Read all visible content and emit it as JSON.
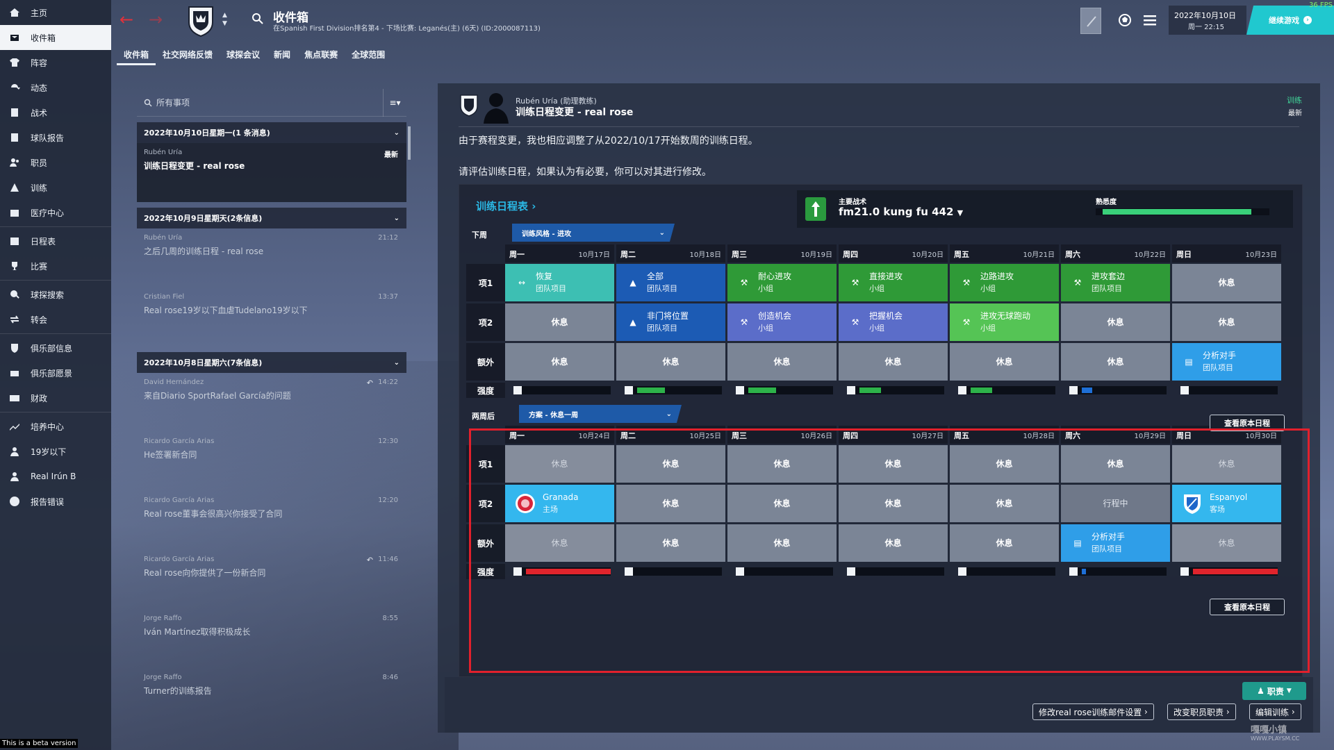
{
  "sidebar": {
    "items": [
      {
        "label": "主页",
        "icon": "home-icon"
      },
      {
        "label": "收件箱",
        "icon": "inbox-icon",
        "active": true
      },
      {
        "label": "阵容",
        "icon": "shirt-icon"
      },
      {
        "label": "动态",
        "icon": "dynamics-icon"
      },
      {
        "label": "战术",
        "icon": "tactics-icon"
      },
      {
        "label": "球队报告",
        "icon": "report-icon"
      },
      {
        "label": "职员",
        "icon": "staff-icon"
      },
      {
        "label": "训练",
        "icon": "training-icon"
      },
      {
        "label": "医疗中心",
        "icon": "medical-icon"
      },
      {
        "label": "日程表",
        "icon": "calendar-icon"
      },
      {
        "label": "比赛",
        "icon": "trophy-icon"
      },
      {
        "label": "球探搜索",
        "icon": "scout-icon"
      },
      {
        "label": "转会",
        "icon": "transfer-icon"
      },
      {
        "label": "俱乐部信息",
        "icon": "club-shield-icon"
      },
      {
        "label": "俱乐部愿景",
        "icon": "vision-icon"
      },
      {
        "label": "财政",
        "icon": "finance-icon"
      },
      {
        "label": "培养中心",
        "icon": "development-icon"
      },
      {
        "label": "19岁以下",
        "icon": "u19-icon"
      },
      {
        "label": "Real Irún B",
        "icon": "reserve-icon"
      },
      {
        "label": "报告错误",
        "icon": "alert-icon"
      }
    ]
  },
  "header": {
    "title": "收件箱",
    "subtitle": "在Spanish First Division排名第4 - 下场比赛: Leganés(主) (6天) (ID:2000087113)",
    "tabs": [
      "收件箱",
      "社交网络反馈",
      "球探会议",
      "新闻",
      "焦点联赛",
      "全球范围"
    ],
    "date": "2022年10月10日",
    "day_time": "周一 22:15",
    "continue_label": "继续游戏",
    "fps": "36 FPS"
  },
  "inbox": {
    "search_placeholder": "所有事项",
    "groups": [
      {
        "title": "2022年10月10日星期一(1 条消息)",
        "messages": [
          {
            "from": "Rubén Uría",
            "subject": "训练日程变更 - real rose",
            "time": "最新",
            "selected": true
          }
        ]
      },
      {
        "title": "2022年10月9日星期天(2条信息)",
        "messages": [
          {
            "from": "Rubén Uría",
            "subject": "之后几周的训练日程 - real rose",
            "time": "21:12"
          },
          {
            "from": "Cristian Fiel",
            "subject": "Real rose19岁以下血虐Tudelano19岁以下",
            "time": "13:37"
          }
        ]
      },
      {
        "title": "2022年10月8日星期六(7条信息)",
        "messages": [
          {
            "from": "David Hernández",
            "subject": "来自Diario SportRafael García的问题",
            "time": "14:22",
            "reply": true
          },
          {
            "from": "Ricardo García Arias",
            "subject": "He签署新合同",
            "time": "12:30"
          },
          {
            "from": "Ricardo García Arias",
            "subject": "Real rose董事会很高兴你接受了合同",
            "time": "12:20"
          },
          {
            "from": "Ricardo García Arias",
            "subject": "Real rose向你提供了一份新合同",
            "time": "11:46",
            "reply": true
          },
          {
            "from": "Jorge Raffo",
            "subject": "Iván Martínez取得积极成长",
            "time": "8:55"
          },
          {
            "from": "Jorge Raffo",
            "subject": "Turner的训练报告",
            "time": "8:46"
          }
        ]
      }
    ]
  },
  "message": {
    "from": "Rubén Uría (助理教练)",
    "title": "训练日程变更 - real rose",
    "tag": "训练",
    "tag_new": "最新",
    "body1": "由于赛程变更，我也相应调整了从2022/10/17开始数周的训练日程。",
    "body2": "请评估训练日程，如果认为有必要，你可以对其进行修改。"
  },
  "schedule": {
    "title": "训练日程表",
    "tactic_label": "主要战术",
    "tactic_value": "fm21.0 kung fu 442",
    "familiarity_label": "熟悉度",
    "familiarity": 0.93,
    "row_labels": [
      "项1",
      "项2",
      "额外",
      "强度"
    ],
    "view_original": "查看原本日程",
    "weeks": [
      {
        "label": "下周",
        "plan": "训练风格 - 进攻",
        "days": [
          {
            "d": "周一",
            "date": "10月17日"
          },
          {
            "d": "周二",
            "date": "10月18日"
          },
          {
            "d": "周三",
            "date": "10月19日"
          },
          {
            "d": "周四",
            "date": "10月20日"
          },
          {
            "d": "周五",
            "date": "10月21日"
          },
          {
            "d": "周六",
            "date": "10月22日"
          },
          {
            "d": "周日",
            "date": "10月23日"
          }
        ],
        "rows": [
          [
            {
              "t": "恢复",
              "s": "团队项目",
              "c": "teal",
              "icon": "recovery-icon"
            },
            {
              "t": "全部",
              "s": "团队项目",
              "c": "blue",
              "icon": "cone-icon"
            },
            {
              "t": "耐心进攻",
              "s": "小组",
              "c": "green",
              "icon": "runner-icon"
            },
            {
              "t": "直接进攻",
              "s": "小组",
              "c": "green",
              "icon": "runner-icon"
            },
            {
              "t": "边路进攻",
              "s": "小组",
              "c": "green",
              "icon": "runner-icon"
            },
            {
              "t": "进攻套边",
              "s": "团队项目",
              "c": "green",
              "icon": "runner-icon"
            },
            {
              "t": "休息",
              "c": "rest"
            }
          ],
          [
            {
              "t": "休息",
              "c": "rest"
            },
            {
              "t": "非门将位置",
              "s": "团队项目",
              "c": "blue",
              "icon": "cone-icon"
            },
            {
              "t": "创造机会",
              "s": "小组",
              "c": "purple",
              "icon": "runner-icon"
            },
            {
              "t": "把握机会",
              "s": "小组",
              "c": "purple",
              "icon": "runner-icon"
            },
            {
              "t": "进攻无球跑动",
              "s": "小组",
              "c": "lgreen",
              "icon": "runner-icon"
            },
            {
              "t": "休息",
              "c": "rest"
            },
            {
              "t": "休息",
              "c": "rest"
            }
          ],
          [
            {
              "t": "休息",
              "c": "rest"
            },
            {
              "t": "休息",
              "c": "rest"
            },
            {
              "t": "休息",
              "c": "rest"
            },
            {
              "t": "休息",
              "c": "rest"
            },
            {
              "t": "休息",
              "c": "rest"
            },
            {
              "t": "休息",
              "c": "rest"
            },
            {
              "t": "分析对手",
              "s": "团队项目",
              "c": "sky",
              "icon": "clipboard-icon"
            }
          ]
        ],
        "intensity": [
          {
            "v": 0,
            "color": "#2db34a"
          },
          {
            "v": 0.33,
            "color": "#2db34a"
          },
          {
            "v": 0.33,
            "color": "#2db34a"
          },
          {
            "v": 0.25,
            "color": "#2db34a"
          },
          {
            "v": 0.25,
            "color": "#2db34a"
          },
          {
            "v": 0.12,
            "color": "#1e6fd6"
          },
          {
            "v": 0,
            "color": "#2db34a"
          }
        ]
      },
      {
        "label": "两周后",
        "plan": "方案 - 休息一周",
        "days": [
          {
            "d": "周一",
            "date": "10月24日"
          },
          {
            "d": "周二",
            "date": "10月25日"
          },
          {
            "d": "周三",
            "date": "10月26日"
          },
          {
            "d": "周四",
            "date": "10月27日"
          },
          {
            "d": "周五",
            "date": "10月28日"
          },
          {
            "d": "周六",
            "date": "10月29日"
          },
          {
            "d": "周日",
            "date": "10月30日"
          }
        ],
        "rows": [
          [
            {
              "t": "休息",
              "c": "rest-dim"
            },
            {
              "t": "休息",
              "c": "rest"
            },
            {
              "t": "休息",
              "c": "rest"
            },
            {
              "t": "休息",
              "c": "rest"
            },
            {
              "t": "休息",
              "c": "rest"
            },
            {
              "t": "休息",
              "c": "rest"
            },
            {
              "t": "休息",
              "c": "rest-dim"
            }
          ],
          [
            {
              "t": "Granada",
              "s": "主场",
              "c": "match",
              "icon": "granada-crest-icon"
            },
            {
              "t": "休息",
              "c": "rest"
            },
            {
              "t": "休息",
              "c": "rest"
            },
            {
              "t": "休息",
              "c": "rest"
            },
            {
              "t": "休息",
              "c": "rest"
            },
            {
              "t": "行程中",
              "c": "inprog"
            },
            {
              "t": "Espanyol",
              "s": "客场",
              "c": "match",
              "icon": "espanyol-crest-icon"
            }
          ],
          [
            {
              "t": "休息",
              "c": "rest-dim"
            },
            {
              "t": "休息",
              "c": "rest"
            },
            {
              "t": "休息",
              "c": "rest"
            },
            {
              "t": "休息",
              "c": "rest"
            },
            {
              "t": "休息",
              "c": "rest"
            },
            {
              "t": "分析对手",
              "s": "团队项目",
              "c": "sky",
              "icon": "clipboard-icon"
            },
            {
              "t": "休息",
              "c": "rest-dim"
            }
          ]
        ],
        "intensity": [
          {
            "v": 1,
            "color": "#e0242c"
          },
          {
            "v": 0,
            "color": "#2db34a"
          },
          {
            "v": 0,
            "color": "#2db34a"
          },
          {
            "v": 0,
            "color": "#2db34a"
          },
          {
            "v": 0,
            "color": "#2db34a"
          },
          {
            "v": 0.05,
            "color": "#1e6fd6"
          },
          {
            "v": 1,
            "color": "#e0242c"
          }
        ]
      }
    ]
  },
  "actions": {
    "staff": "职责",
    "modify_mail": "修改real rose训练邮件设置",
    "change_staff": "改变职员职责",
    "edit_training": "编辑训练"
  },
  "beta_text": "This is a beta version",
  "watermark": "嘎嘎小镇",
  "watermark_url": "WWW.PLAYSM.CC"
}
